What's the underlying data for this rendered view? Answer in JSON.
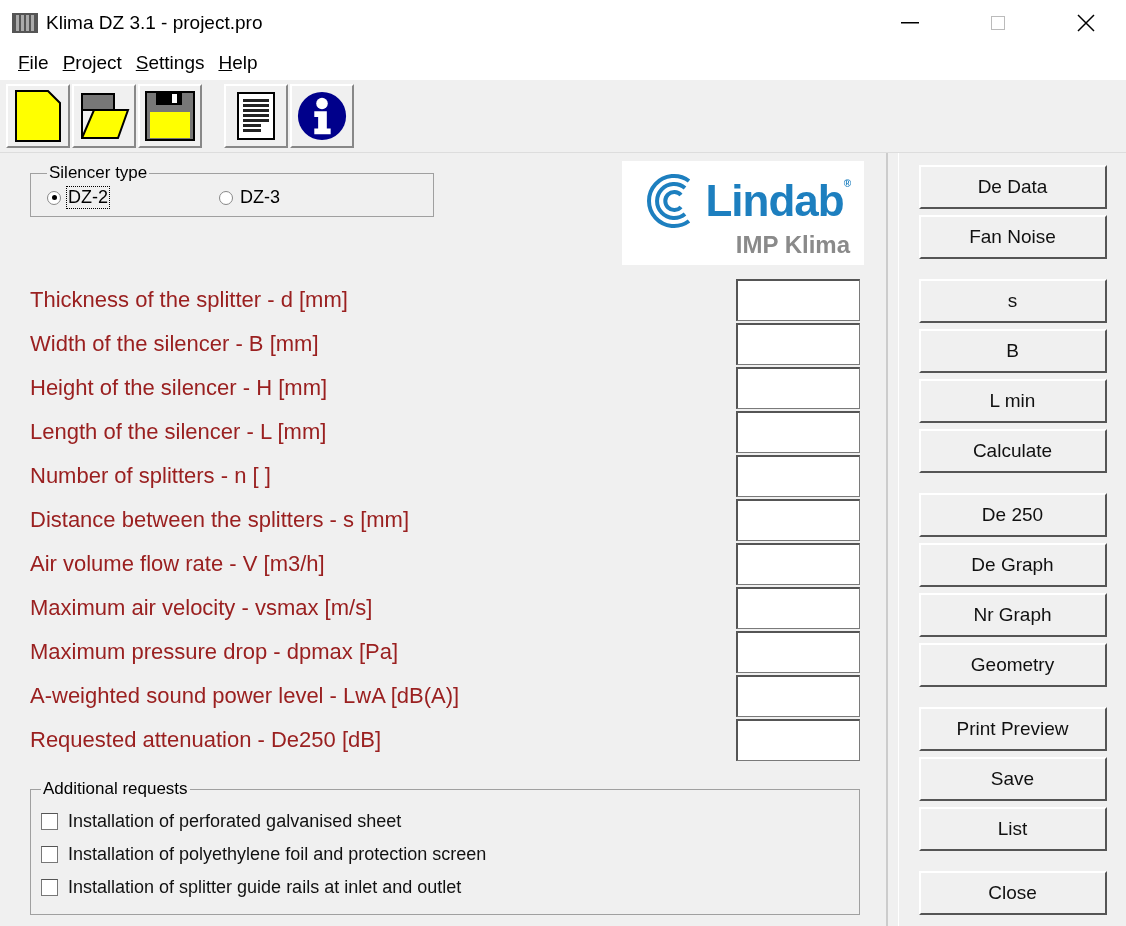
{
  "window": {
    "title": "Klima DZ 3.1 - project.pro"
  },
  "menu": [
    {
      "label": "File"
    },
    {
      "label": "Project"
    },
    {
      "label": "Settings"
    },
    {
      "label": "Help"
    }
  ],
  "toolbar": [
    {
      "kind": "new"
    },
    {
      "kind": "open"
    },
    {
      "kind": "save"
    },
    {
      "kind": "report"
    },
    {
      "kind": "info"
    }
  ],
  "silencer_type": {
    "title": "Silencer type",
    "options": [
      {
        "label": "DZ-2",
        "selected": true
      },
      {
        "label": "DZ-3",
        "selected": false
      }
    ]
  },
  "logo": {
    "name": "Lindab$^{®}$",
    "subtitle": "IMP Klima"
  },
  "fields": [
    {
      "label": "Thickness of the splitter - d [mm]"
    },
    {
      "label": "Width of the silencer - B [mm]"
    },
    {
      "label": "Height of the silencer - H [mm]"
    },
    {
      "label": "Length of the silencer - L [mm]"
    },
    {
      "label": "Number of splitters - n [ ]"
    },
    {
      "label": "Distance between the splitters - s [mm]"
    },
    {
      "label": "Air volume flow rate - V [m3/h]"
    },
    {
      "label": "Maximum air velocity - vsmax [m/s]"
    },
    {
      "label": "Maximum pressure drop - dpmax [Pa]"
    },
    {
      "label": "A-weighted sound power level - LwA [dB(A)]"
    },
    {
      "label": "Requested attenuation - De250 [dB]"
    }
  ],
  "additional_requests": {
    "title": "Additional requests",
    "items": [
      {
        "label": "Installation of perforated galvanised sheet",
        "checked": false
      },
      {
        "label": "Installation of polyethylene foil and protection screen",
        "checked": false
      },
      {
        "label": "Installation of splitter guide rails at inlet and outlet",
        "checked": false
      }
    ]
  },
  "button_groups": [
    [
      "De Data",
      "Fan Noise"
    ],
    [
      "s",
      "B",
      "L min",
      "Calculate"
    ],
    [
      "De 250",
      "De Graph",
      "Nr Graph",
      "Geometry"
    ],
    [
      "Print Preview",
      "Save",
      "List"
    ],
    [
      "Close"
    ]
  ]
}
